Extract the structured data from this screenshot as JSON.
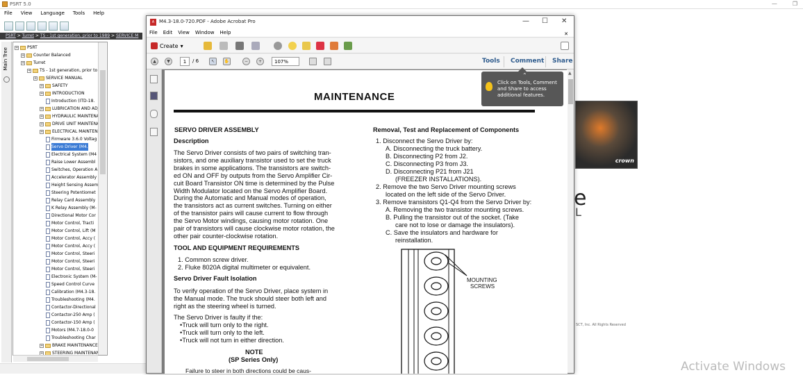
{
  "psrt": {
    "title": "PSRT 5.0",
    "menu": [
      "File",
      "View",
      "Language",
      "Tools",
      "Help"
    ],
    "breadcrumb": [
      "PSRT",
      "Turret",
      "TS - 1st generation, prior to 1989",
      "SERVICE M"
    ],
    "tab_label": "Main Tree",
    "tree": [
      {
        "label": "PSRT",
        "level": 0,
        "type": "folder"
      },
      {
        "label": "Counter Balanced",
        "level": 1,
        "type": "folder"
      },
      {
        "label": "Turret",
        "level": 1,
        "type": "folder"
      },
      {
        "label": "TS - 1st generation, prior to 19",
        "level": 2,
        "type": "folder"
      },
      {
        "label": "SERVICE MANUAL",
        "level": 3,
        "type": "folder"
      },
      {
        "label": "SAFETY",
        "level": 4,
        "type": "folder"
      },
      {
        "label": "INTRODUCTION",
        "level": 4,
        "type": "folder"
      },
      {
        "label": "Introduction (ITD-18.",
        "level": 5,
        "type": "doc"
      },
      {
        "label": "LUBRICATION AND ADJU",
        "level": 4,
        "type": "folder"
      },
      {
        "label": "HYDRAULIC MAINTENAN",
        "level": 4,
        "type": "folder"
      },
      {
        "label": "DRIVE UNIT MAINTENAN",
        "level": 4,
        "type": "folder"
      },
      {
        "label": "ELECTRICAL MAINTENAN",
        "level": 4,
        "type": "folder"
      },
      {
        "label": "Firmware 3.6.0 Voltag",
        "level": 5,
        "type": "doc"
      },
      {
        "label": "Servo Driver (M4.",
        "level": 5,
        "type": "doc",
        "selected": true
      },
      {
        "label": "Electrical System (M4",
        "level": 5,
        "type": "doc"
      },
      {
        "label": "Raise Lower Assembl",
        "level": 5,
        "type": "doc"
      },
      {
        "label": "Switches, Operation A",
        "level": 5,
        "type": "doc"
      },
      {
        "label": "Accelerator Assembly",
        "level": 5,
        "type": "doc"
      },
      {
        "label": "Height Sensing Assem",
        "level": 5,
        "type": "doc"
      },
      {
        "label": "Steering Potentiomet",
        "level": 5,
        "type": "doc"
      },
      {
        "label": "Relay Card Assembly",
        "level": 5,
        "type": "doc"
      },
      {
        "label": "K Relay Assembly (M-",
        "level": 5,
        "type": "doc"
      },
      {
        "label": "Directional Motor Cor",
        "level": 5,
        "type": "doc"
      },
      {
        "label": "Motor Control, Tracti",
        "level": 5,
        "type": "doc"
      },
      {
        "label": "Motor Control, Lift (M",
        "level": 5,
        "type": "doc"
      },
      {
        "label": "Motor Control, Accy (",
        "level": 5,
        "type": "doc"
      },
      {
        "label": "Motor Control, Accy (",
        "level": 5,
        "type": "doc"
      },
      {
        "label": "Motor Control, Steeri",
        "level": 5,
        "type": "doc"
      },
      {
        "label": "Motor Control, Steeri",
        "level": 5,
        "type": "doc"
      },
      {
        "label": "Motor Control, Steeri",
        "level": 5,
        "type": "doc"
      },
      {
        "label": "Electronic System (M-",
        "level": 5,
        "type": "doc"
      },
      {
        "label": "Speed Control Curve",
        "level": 5,
        "type": "doc"
      },
      {
        "label": "Calibration (M4.3-18.",
        "level": 5,
        "type": "doc"
      },
      {
        "label": "Troubleshooting (M4.",
        "level": 5,
        "type": "doc"
      },
      {
        "label": "Contactor-Directional",
        "level": 5,
        "type": "doc"
      },
      {
        "label": "Contactor-250 Amp (",
        "level": 5,
        "type": "doc"
      },
      {
        "label": "Contactor-150 Amp (",
        "level": 5,
        "type": "doc"
      },
      {
        "label": "Motors (M4.7-18.0-0",
        "level": 5,
        "type": "doc"
      },
      {
        "label": "Troubleshooting Char",
        "level": 5,
        "type": "doc"
      },
      {
        "label": "BRAKE MAINTENANCE",
        "level": 4,
        "type": "folder"
      },
      {
        "label": "STEERING MAINTENANC",
        "level": 4,
        "type": "folder"
      }
    ],
    "right_big_letter": "e",
    "right_small_letter": "L",
    "copyright": "SCT, Inc. All Rights Reserved",
    "crown_text": "crown",
    "watermark": "Activate Windows"
  },
  "acrobat": {
    "title": "M4.3-18.0-720.PDF - Adobe Acrobat Pro",
    "menu": [
      "File",
      "Edit",
      "View",
      "Window",
      "Help"
    ],
    "create_label": "Create",
    "page_current": "1",
    "page_total": "/ 6",
    "zoom": "107%",
    "tools_label": "Tools",
    "comment_label": "Comment",
    "share_label": "Share",
    "tooltip": "Click on Tools, Comment and Share to access additional features.",
    "icons": [
      "open-icon",
      "save-icon",
      "print-icon",
      "email-icon",
      "settings-icon",
      "comment-icon",
      "stamp-icon",
      "sign-icon",
      "export-icon",
      "edit-icon"
    ]
  },
  "pdf": {
    "heading": "MAINTENANCE",
    "left": {
      "section": "SERVO DRIVER ASSEMBLY",
      "desc_heading": "Description",
      "desc_lines": [
        "The Servo Driver consists of two pairs of switching tran-",
        "sistors, and one auxiliary transistor used to set the truck",
        "brakes in some applications. The transistors are switch-",
        "ed ON and OFF by outputs from the Servo Amplifier Cir-",
        "cuit Board Transistor ON time is determined by the Pulse",
        "Width Modulator located on the Servo Amplifier Board.",
        "During the Automatic and Manual modes of operation,",
        "the transistors act as current switches. Turning on either",
        "of the transistor pairs will cause current to flow through",
        "the Servo Motor windings, causing motor rotation. One",
        "pair of transistors will cause clockwise motor rotation, the",
        "other pair counter-clockwise rotation."
      ],
      "tools_heading": "TOOL AND EQUIPMENT REQUIREMENTS",
      "tools": [
        "1. Common screw driver.",
        "2. Fluke 8020A digital multimeter or equivalent."
      ],
      "fault_heading": "Servo Driver Fault Isolation",
      "fault_lines": [
        "To verify operation of the Servo Driver, place system in",
        "the Manual mode. The truck should steer both left and",
        "right as the steering wheel is turned."
      ],
      "faulty_intro": "The Servo Driver is faulty if the:",
      "faulty_items": [
        "•Truck will turn only to the right.",
        "•Truck will turn only to the left.",
        "•Truck will not turn in either direction."
      ],
      "note_heading": "NOTE",
      "note_sub": "(SP Series Only)",
      "note_text": "Failure to steer in both directions could be caus-"
    },
    "right": {
      "heading": "Removal, Test and Replacement of Components",
      "lines": [
        "1.  Disconnect the Servo Driver by:",
        "A. Disconnecting the truck battery.",
        "B. Disconnecting P2 from J2.",
        "C. Disconnecting P3 from J3.",
        "D. Disconnecting P21 from J21",
        "(FREEZER INSTALLATIONS).",
        "2.  Remove the two Servo Driver mounting screws",
        "located on the left side of the Servo Driver.",
        "3.  Remove transistors Q1-Q4 from the Servo Driver by:",
        "A. Removing the two transistor mounting screws.",
        "B. Pulling the transistor out of the socket. (Take",
        "care not to lose or damage the insulators).",
        "C.  Save  the  insulators  and  hardware  for",
        "reinstallation."
      ],
      "figure_label_1": "MOUNTING",
      "figure_label_2": "SCREWS"
    }
  }
}
